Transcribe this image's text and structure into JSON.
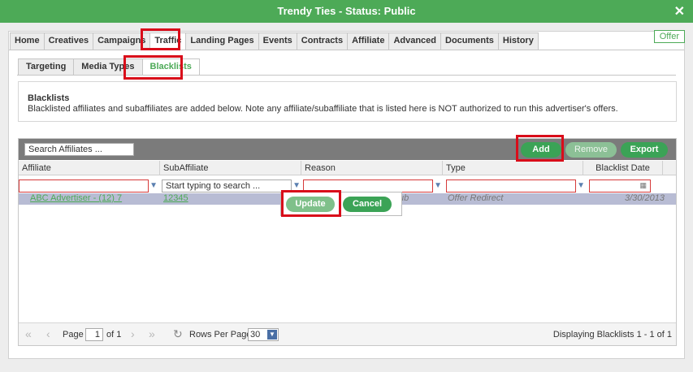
{
  "window": {
    "title": "Trendy Ties - Status: Public",
    "close_glyph": "✕"
  },
  "tabs": [
    "Home",
    "Creatives",
    "Campaigns",
    "Traffic",
    "Landing Pages",
    "Events",
    "Contracts",
    "Affiliate",
    "Advanced",
    "Documents",
    "History"
  ],
  "offer_badge": "Offer",
  "subtabs": [
    "Targeting",
    "Media Types",
    "Blacklists"
  ],
  "info": {
    "heading": "Blacklists",
    "description": "Blacklisted affiliates and subaffiliates are added below. Note any affiliate/subaffiliate that is listed here is NOT authorized to run this advertiser's offers."
  },
  "toolbar": {
    "search_placeholder": "Search Affiliates ...",
    "add": "Add",
    "remove": "Remove",
    "export": "Export"
  },
  "columns": [
    "Affiliate",
    "SubAffiliate",
    "Reason",
    "Type",
    "Blacklist Date"
  ],
  "filters": {
    "subaffiliate_placeholder": "Start typing to search ..."
  },
  "row": {
    "affiliate": "ABC Advertiser - (12) 7",
    "subaffiliate": "12345",
    "reason": "ub",
    "type": "Offer Redirect",
    "date": "3/30/2013"
  },
  "popup": {
    "update": "Update",
    "cancel": "Cancel"
  },
  "pager": {
    "page_label": "Page",
    "page": "1",
    "of": "of 1",
    "rows_label": "Rows Per Page:",
    "rows": "30",
    "display": "Displaying Blacklists 1 - 1 of 1"
  },
  "colors": {
    "brand_green": "#4daa57",
    "highlight_red": "#d90d1a"
  }
}
